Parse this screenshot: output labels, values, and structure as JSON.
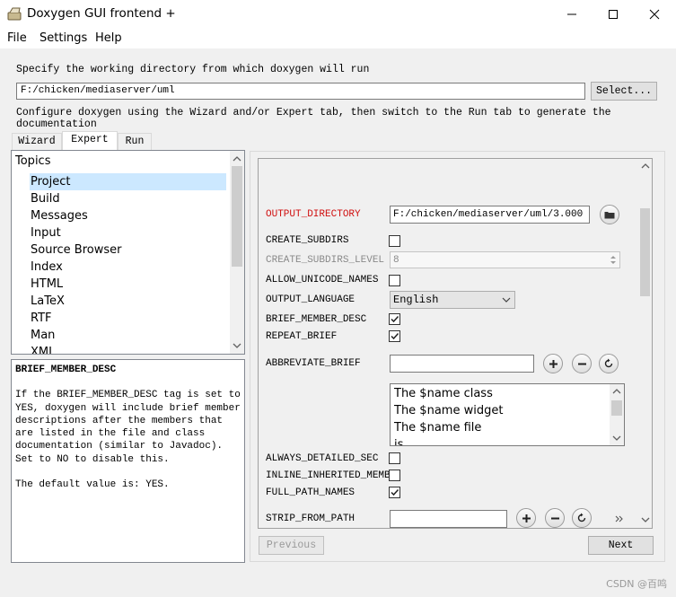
{
  "window": {
    "title": "Doxygen GUI frontend +"
  },
  "menu": {
    "file": "File",
    "settings": "Settings",
    "help": "Help"
  },
  "workdir": {
    "prompt": "Specify the working directory from which doxygen will run",
    "value": "F:/chicken/mediaserver/uml",
    "select_label": "Select...",
    "hint": "Configure doxygen using the Wizard and/or Expert tab, then switch to the Run tab to generate the documentation"
  },
  "tabs": [
    {
      "label": "Wizard",
      "active": false
    },
    {
      "label": "Expert",
      "active": true
    },
    {
      "label": "Run",
      "active": false
    }
  ],
  "topics": {
    "header": "Topics",
    "items": [
      "Project",
      "Build",
      "Messages",
      "Input",
      "Source Browser",
      "Index",
      "HTML",
      "LaTeX",
      "RTF",
      "Man",
      "XML"
    ],
    "selected": "Project"
  },
  "help": {
    "title": "BRIEF_MEMBER_DESC",
    "body": "If the BRIEF_MEMBER_DESC tag is set to YES, doxygen will include brief member descriptions after the members that are listed in the file and class documentation (similar to Javadoc). Set to NO to disable this.",
    "default": "The default value is: YES."
  },
  "options": {
    "output_directory": {
      "label": "OUTPUT_DIRECTORY",
      "value": "F:/chicken/mediaserver/uml/3.000"
    },
    "create_subdirs": {
      "label": "CREATE_SUBDIRS",
      "checked": false
    },
    "create_subdirs_level": {
      "label": "CREATE_SUBDIRS_LEVEL",
      "value": "8"
    },
    "allow_unicode_names": {
      "label": "ALLOW_UNICODE_NAMES",
      "checked": false
    },
    "output_language": {
      "label": "OUTPUT_LANGUAGE",
      "value": "English"
    },
    "brief_member_desc": {
      "label": "BRIEF_MEMBER_DESC",
      "checked": true
    },
    "repeat_brief": {
      "label": "REPEAT_BRIEF",
      "checked": true
    },
    "abbreviate_brief": {
      "label": "ABBREVIATE_BRIEF",
      "value": "",
      "list": [
        "The $name class",
        "The $name widget",
        "The $name file",
        "is"
      ]
    },
    "always_detailed_sec": {
      "label": "ALWAYS_DETAILED_SEC",
      "checked": false
    },
    "inline_inherited_memb": {
      "label": "INLINE_INHERITED_MEMB",
      "checked": false
    },
    "full_path_names": {
      "label": "FULL_PATH_NAMES",
      "checked": true
    },
    "strip_from_path": {
      "label": "STRIP_FROM_PATH",
      "value": ""
    }
  },
  "nav": {
    "previous": "Previous",
    "next": "Next"
  },
  "icons": [
    "app-icon",
    "minimize-icon",
    "maximize-icon",
    "close-icon",
    "folder-icon",
    "plus-icon",
    "minus-icon",
    "reset-icon"
  ],
  "watermark": "CSDN @百鸣",
  "colors": {
    "selection": "#cce8ff",
    "required_option": "#d01010",
    "disabled_text": "#8a8a8a"
  }
}
